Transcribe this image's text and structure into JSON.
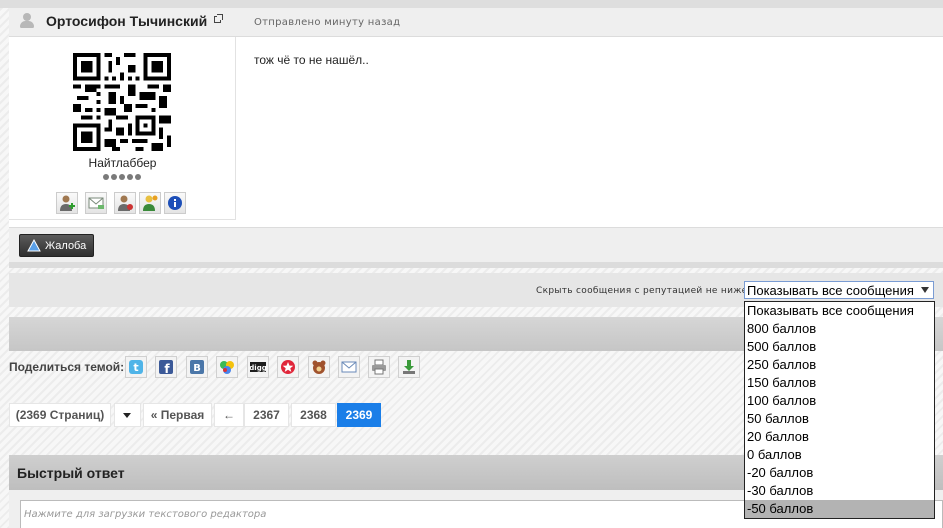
{
  "post": {
    "author_name": "Ортосифон Тычинский",
    "sent_time": "Отправлено минуту назад",
    "author_rank": "Найтлаббер",
    "rank_pips": 5,
    "author_icons": [
      "add-friend-icon",
      "envelope-icon",
      "view-profile-icon",
      "ignore-user-icon",
      "info-icon"
    ],
    "text": "тож чё то не нашёл.."
  },
  "report": {
    "label": "Жалоба"
  },
  "filter": {
    "label": "Скрыть сообщения с репутацией не ниже",
    "selected": "Показывать все сообщения",
    "options": [
      "Показывать все сообщения",
      "800 баллов",
      "500 баллов",
      "250 баллов",
      "150 баллов",
      "100 баллов",
      "50 баллов",
      "20 баллов",
      "0 баллов",
      "-20 баллов",
      "-30 баллов",
      "-50 баллов"
    ],
    "highlighted_option": "-50 баллов"
  },
  "share": {
    "label": "Поделиться темой:",
    "icons": [
      "twitter-icon",
      "facebook-icon",
      "vkontakte-icon",
      "google-buzz-icon",
      "digg-icon",
      "star-bookmark-icon",
      "mail-ru-icon",
      "email-icon",
      "print-icon",
      "download-icon"
    ]
  },
  "pagination": {
    "total": "(2369 Страниц)",
    "first": "« Первая",
    "prev": "←",
    "pages": [
      "2367",
      "2368",
      "2369"
    ],
    "current": "2369"
  },
  "quick_reply": {
    "title": "Быстрый ответ",
    "placeholder": "Нажмите для загрузки текстового редактора"
  },
  "colors": {
    "accent": "#1a7ee8",
    "header_bg": "#efefef",
    "dropdown_highlight": "#b3b3b3"
  }
}
